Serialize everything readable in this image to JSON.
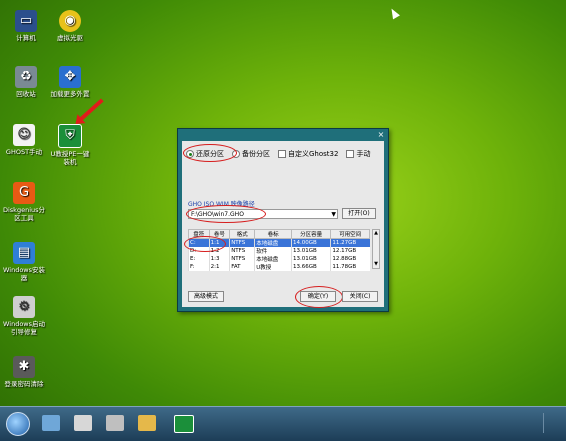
{
  "desktop_icons": [
    {
      "label": "计算机",
      "icon": "computer-icon"
    },
    {
      "label": "虚拟光驱",
      "icon": "disc-icon"
    },
    {
      "label": "回收站",
      "icon": "recycle-bin-icon"
    },
    {
      "label": "加载更多外置",
      "icon": "expand-icon"
    },
    {
      "label": "GHOST手动",
      "icon": "ghost-icon"
    },
    {
      "label": "U教授PE一键装机",
      "icon": "installer-icon"
    },
    {
      "label": "Diskgenius分区工具",
      "icon": "diskgenius-icon"
    },
    {
      "label": "Windows安装器",
      "icon": "windows-installer-icon"
    },
    {
      "label": "Windows启动引导修复",
      "icon": "boot-repair-icon"
    },
    {
      "label": "登录密码清除",
      "icon": "password-icon"
    }
  ],
  "dialog": {
    "close": "×",
    "options": {
      "restore": "还原分区",
      "backup": "备份分区",
      "custom": "自定义Ghost32",
      "manual": "手动"
    },
    "path_label": "GHO ISO WIM 映像路径",
    "path_value": "F:\\GHO\\win7.GHO",
    "open_button": "打开(O)",
    "table_headers": [
      "盘符",
      "卷号",
      "格式",
      "卷标",
      "分区容量",
      "可用空间"
    ],
    "rows": [
      {
        "drive": "C:",
        "vol": "1:1",
        "fmt": "NTFS",
        "label": "本地磁盘",
        "size": "14.00GB",
        "free": "11.27GB",
        "selected": true
      },
      {
        "drive": "D:",
        "vol": "1:2",
        "fmt": "NTFS",
        "label": "软件",
        "size": "13.01GB",
        "free": "12.17GB",
        "selected": false
      },
      {
        "drive": "E:",
        "vol": "1:3",
        "fmt": "NTFS",
        "label": "本地磁盘",
        "size": "13.01GB",
        "free": "12.88GB",
        "selected": false
      },
      {
        "drive": "F:",
        "vol": "2:1",
        "fmt": "FAT",
        "label": "U教授",
        "size": "13.66GB",
        "free": "11.78GB",
        "selected": false
      }
    ],
    "advanced_button": "高级模式",
    "ok_button": "确定(Y)",
    "close_button": "关闭(C)"
  },
  "colors": {
    "desktop": "#6eb20a",
    "dialog_frame": "#1f6f7a",
    "highlight": "#d61e1e",
    "row_selected": "#3a74d8"
  }
}
